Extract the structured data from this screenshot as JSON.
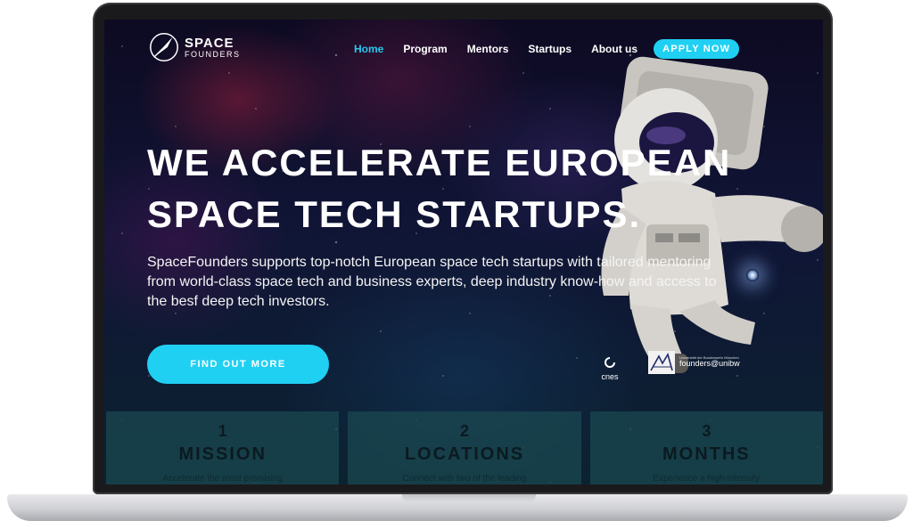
{
  "brand": {
    "line1": "SPACE",
    "line2": "FOUNDERS"
  },
  "nav": {
    "items": [
      {
        "label": "Home",
        "active": true
      },
      {
        "label": "Program",
        "active": false
      },
      {
        "label": "Mentors",
        "active": false
      },
      {
        "label": "Startups",
        "active": false
      },
      {
        "label": "About us",
        "active": false
      }
    ],
    "cta": "APPLY NOW"
  },
  "hero": {
    "title_line1": "WE ACCELERATE EUROPEAN",
    "title_line2": "SPACE TECH STARTUPS.",
    "text": "SpaceFounders supports top-notch European space tech startups with tailored mentoring from world-class space tech and business experts, deep industry know-how and access to the besf deep tech investors.",
    "button": "FIND OUT MORE"
  },
  "partners": {
    "cnes": "cnes",
    "unibw_small": "Universität der Bundeswehr München",
    "unibw": "founders@unibw"
  },
  "stats": [
    {
      "number": "1",
      "label": "MISSION",
      "sub": "Accelerate the most promising"
    },
    {
      "number": "2",
      "label": "LOCATIONS",
      "sub": "Connect with two of the leading"
    },
    {
      "number": "3",
      "label": "MONTHS",
      "sub": "Experience a high-intensity"
    }
  ],
  "colors": {
    "accent": "#20d0f3",
    "nav_active": "#27c9ee"
  }
}
